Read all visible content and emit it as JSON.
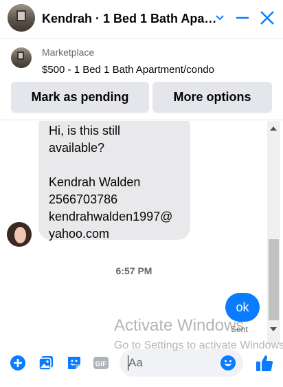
{
  "header": {
    "title": "Kendrah · 1 Bed 1 Bath Apa…",
    "icons": [
      "chevron-down-icon",
      "minimize-icon",
      "close-icon"
    ]
  },
  "marketplace": {
    "label": "Marketplace",
    "product": "$500 - 1 Bed 1 Bath Apartment/condo",
    "pending_button": "Mark as pending",
    "more_button": "More options"
  },
  "thread": {
    "incoming_message": "Hi, is this still\navailable?\n\nKendrah Walden\n2566703786\nkendrahwalden1997@\nyahoo.com",
    "timestamp": "6:57 PM",
    "outgoing_message": "ok",
    "status": "Sent"
  },
  "watermark": {
    "line1": "Activate Windows",
    "line2": "Go to Settings to activate Windows."
  },
  "composer": {
    "placeholder": "Aa",
    "icons": [
      "plus-icon",
      "gallery-icon",
      "sticker-icon",
      "gif-icon",
      "emoji-icon",
      "like-icon"
    ]
  },
  "colors": {
    "accent": "#0a7cff",
    "bubble_incoming": "#e9e9eb",
    "pill_bg": "#e4e6eb",
    "muted_text": "#65676b"
  }
}
